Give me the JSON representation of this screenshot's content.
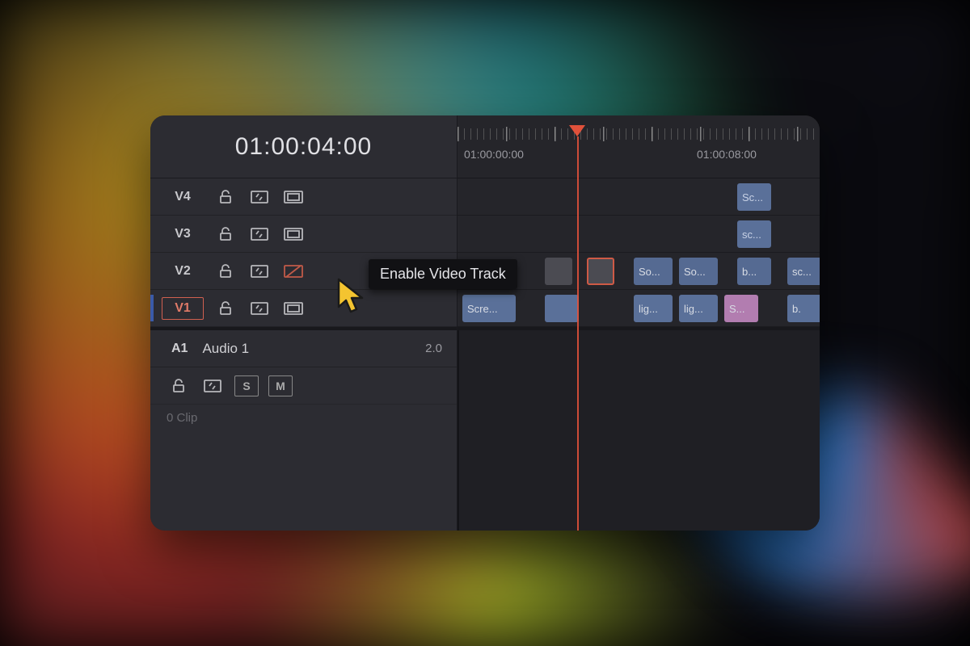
{
  "timecode": "01:00:04:00",
  "ruler": {
    "label1": "01:00:00:00",
    "label2": "01:00:08:00"
  },
  "tracks": {
    "v4": "V4",
    "v3": "V3",
    "v2": "V2",
    "v1": "V1"
  },
  "audio": {
    "id": "A1",
    "name": "Audio 1",
    "volume": "2.0",
    "solo": "S",
    "mute": "M",
    "clip_count": "0 Clip"
  },
  "tooltip": "Enable Video Track",
  "clips": {
    "v4_1": "Sc...",
    "v3_1": "sc...",
    "v2_so1": "So...",
    "v2_so2": "So...",
    "v2_b": "b...",
    "v2_sc": "sc...",
    "v1_scre": "Scre...",
    "v1_lig1": "lig...",
    "v1_lig2": "lig...",
    "v1_s": "S...",
    "v1_b": "b."
  }
}
